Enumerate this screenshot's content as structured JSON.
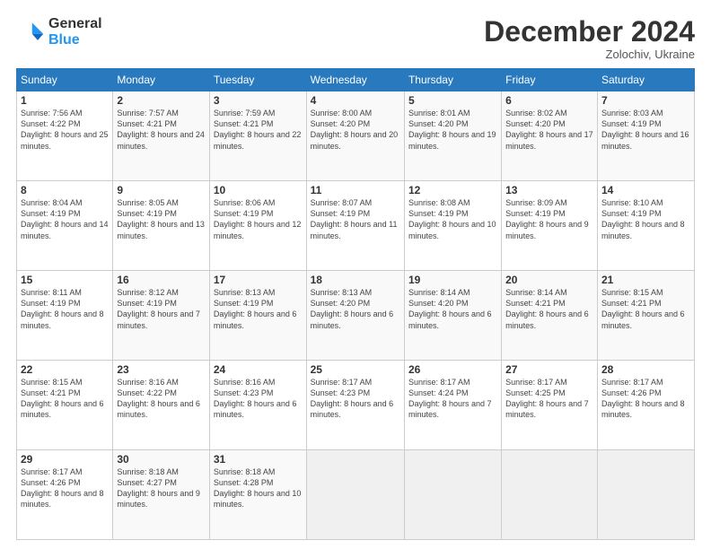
{
  "logo": {
    "general": "General",
    "blue": "Blue"
  },
  "title": "December 2024",
  "location": "Zolochiv, Ukraine",
  "weekdays": [
    "Sunday",
    "Monday",
    "Tuesday",
    "Wednesday",
    "Thursday",
    "Friday",
    "Saturday"
  ],
  "weeks": [
    [
      {
        "day": "1",
        "sunrise": "7:56 AM",
        "sunset": "4:22 PM",
        "daylight": "8 hours and 25 minutes."
      },
      {
        "day": "2",
        "sunrise": "7:57 AM",
        "sunset": "4:21 PM",
        "daylight": "8 hours and 24 minutes."
      },
      {
        "day": "3",
        "sunrise": "7:59 AM",
        "sunset": "4:21 PM",
        "daylight": "8 hours and 22 minutes."
      },
      {
        "day": "4",
        "sunrise": "8:00 AM",
        "sunset": "4:20 PM",
        "daylight": "8 hours and 20 minutes."
      },
      {
        "day": "5",
        "sunrise": "8:01 AM",
        "sunset": "4:20 PM",
        "daylight": "8 hours and 19 minutes."
      },
      {
        "day": "6",
        "sunrise": "8:02 AM",
        "sunset": "4:20 PM",
        "daylight": "8 hours and 17 minutes."
      },
      {
        "day": "7",
        "sunrise": "8:03 AM",
        "sunset": "4:19 PM",
        "daylight": "8 hours and 16 minutes."
      }
    ],
    [
      {
        "day": "8",
        "sunrise": "8:04 AM",
        "sunset": "4:19 PM",
        "daylight": "8 hours and 14 minutes."
      },
      {
        "day": "9",
        "sunrise": "8:05 AM",
        "sunset": "4:19 PM",
        "daylight": "8 hours and 13 minutes."
      },
      {
        "day": "10",
        "sunrise": "8:06 AM",
        "sunset": "4:19 PM",
        "daylight": "8 hours and 12 minutes."
      },
      {
        "day": "11",
        "sunrise": "8:07 AM",
        "sunset": "4:19 PM",
        "daylight": "8 hours and 11 minutes."
      },
      {
        "day": "12",
        "sunrise": "8:08 AM",
        "sunset": "4:19 PM",
        "daylight": "8 hours and 10 minutes."
      },
      {
        "day": "13",
        "sunrise": "8:09 AM",
        "sunset": "4:19 PM",
        "daylight": "8 hours and 9 minutes."
      },
      {
        "day": "14",
        "sunrise": "8:10 AM",
        "sunset": "4:19 PM",
        "daylight": "8 hours and 8 minutes."
      }
    ],
    [
      {
        "day": "15",
        "sunrise": "8:11 AM",
        "sunset": "4:19 PM",
        "daylight": "8 hours and 8 minutes."
      },
      {
        "day": "16",
        "sunrise": "8:12 AM",
        "sunset": "4:19 PM",
        "daylight": "8 hours and 7 minutes."
      },
      {
        "day": "17",
        "sunrise": "8:13 AM",
        "sunset": "4:19 PM",
        "daylight": "8 hours and 6 minutes."
      },
      {
        "day": "18",
        "sunrise": "8:13 AM",
        "sunset": "4:20 PM",
        "daylight": "8 hours and 6 minutes."
      },
      {
        "day": "19",
        "sunrise": "8:14 AM",
        "sunset": "4:20 PM",
        "daylight": "8 hours and 6 minutes."
      },
      {
        "day": "20",
        "sunrise": "8:14 AM",
        "sunset": "4:21 PM",
        "daylight": "8 hours and 6 minutes."
      },
      {
        "day": "21",
        "sunrise": "8:15 AM",
        "sunset": "4:21 PM",
        "daylight": "8 hours and 6 minutes."
      }
    ],
    [
      {
        "day": "22",
        "sunrise": "8:15 AM",
        "sunset": "4:21 PM",
        "daylight": "8 hours and 6 minutes."
      },
      {
        "day": "23",
        "sunrise": "8:16 AM",
        "sunset": "4:22 PM",
        "daylight": "8 hours and 6 minutes."
      },
      {
        "day": "24",
        "sunrise": "8:16 AM",
        "sunset": "4:23 PM",
        "daylight": "8 hours and 6 minutes."
      },
      {
        "day": "25",
        "sunrise": "8:17 AM",
        "sunset": "4:23 PM",
        "daylight": "8 hours and 6 minutes."
      },
      {
        "day": "26",
        "sunrise": "8:17 AM",
        "sunset": "4:24 PM",
        "daylight": "8 hours and 7 minutes."
      },
      {
        "day": "27",
        "sunrise": "8:17 AM",
        "sunset": "4:25 PM",
        "daylight": "8 hours and 7 minutes."
      },
      {
        "day": "28",
        "sunrise": "8:17 AM",
        "sunset": "4:26 PM",
        "daylight": "8 hours and 8 minutes."
      }
    ],
    [
      {
        "day": "29",
        "sunrise": "8:17 AM",
        "sunset": "4:26 PM",
        "daylight": "8 hours and 8 minutes."
      },
      {
        "day": "30",
        "sunrise": "8:18 AM",
        "sunset": "4:27 PM",
        "daylight": "8 hours and 9 minutes."
      },
      {
        "day": "31",
        "sunrise": "8:18 AM",
        "sunset": "4:28 PM",
        "daylight": "8 hours and 10 minutes."
      },
      null,
      null,
      null,
      null
    ]
  ]
}
